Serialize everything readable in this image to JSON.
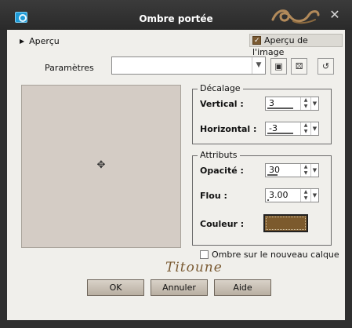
{
  "window": {
    "title": "Ombre portée"
  },
  "preview": {
    "expander_label": "Aperçu",
    "image_preview_label": "Aperçu de l'image",
    "image_preview_checked": true
  },
  "params": {
    "label": "Paramètres",
    "preset_value": ""
  },
  "offset": {
    "legend": "Décalage",
    "vertical_label": "Vertical :",
    "vertical_value": "3",
    "vertical_level": 0.1,
    "horizontal_label": "Horizontal :",
    "horizontal_value": "-3",
    "horizontal_level": 0.1
  },
  "attributes": {
    "legend": "Attributs",
    "opacity_label": "Opacité :",
    "opacity_value": "30",
    "opacity_level": 0.3,
    "blur_label": "Flou :",
    "blur_value": "3.00",
    "blur_level": 0.03,
    "color_label": "Couleur :",
    "color_value": "#7c5a2d"
  },
  "new_layer": {
    "label": "Ombre sur le nouveau calque",
    "checked": false
  },
  "signature": "Titoune",
  "buttons": {
    "ok": "OK",
    "cancel": "Annuler",
    "help": "Aide"
  }
}
